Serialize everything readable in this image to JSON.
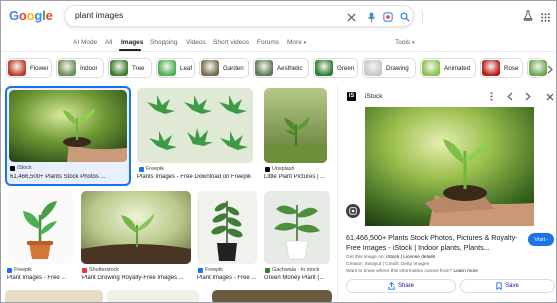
{
  "brand": {
    "logo_letters": [
      {
        "ch": "G",
        "color": "#4285F4"
      },
      {
        "ch": "o",
        "color": "#EA4335"
      },
      {
        "ch": "o",
        "color": "#FBBC05"
      },
      {
        "ch": "g",
        "color": "#4285F4"
      },
      {
        "ch": "l",
        "color": "#34A853"
      },
      {
        "ch": "e",
        "color": "#EA4335"
      }
    ]
  },
  "search": {
    "query": "plant images",
    "icons": [
      "close-icon",
      "mic-icon",
      "lens-icon",
      "search-icon"
    ]
  },
  "header_right": {
    "icons": [
      "labs-flask-icon",
      "apps-grid-icon"
    ]
  },
  "nav": {
    "tabs": [
      {
        "label": "AI Mode"
      },
      {
        "label": "All"
      },
      {
        "label": "Images",
        "active": true
      },
      {
        "label": "Shopping"
      },
      {
        "label": "Videos"
      },
      {
        "label": "Short videos"
      },
      {
        "label": "Forums"
      },
      {
        "label": "More"
      }
    ],
    "tools_label": "Tools"
  },
  "chips": [
    {
      "label": "Flower",
      "color": "#c0392b"
    },
    {
      "label": "Indoor",
      "color": "#6b8e5a"
    },
    {
      "label": "Tree",
      "color": "#3f7d2e"
    },
    {
      "label": "Leaf",
      "color": "#4caf50"
    },
    {
      "label": "Garden",
      "color": "#7a6a4f"
    },
    {
      "label": "Aesthetic",
      "color": "#5d7a52"
    },
    {
      "label": "Green",
      "color": "#2e7d32"
    },
    {
      "label": "Drawing",
      "color": "#c8c8c8"
    },
    {
      "label": "Animated",
      "color": "#8bc34a"
    },
    {
      "label": "Rose",
      "color": "#b71c1c"
    },
    {
      "label": "",
      "color": "#6aa84f"
    }
  ],
  "results": [
    {
      "source": "iStock",
      "caption": "61,466,500+ Plants Stock Photos ...",
      "selected": true
    },
    {
      "source": "Freepik",
      "caption": "Plants Images - Free Download on Freepik"
    },
    {
      "source": "Unsplash",
      "caption": "Little Plant Pictures | ..."
    },
    {
      "source": "Freepik",
      "caption": "Plant Images - Free ..."
    },
    {
      "source": "Shutterstock",
      "caption": "Plant Growing Royalty-Free Images ..."
    },
    {
      "source": "Freepik",
      "caption": "Plant Images - Free ..."
    },
    {
      "source": "Gachwala · In stock",
      "caption": "Green Money Plant (..."
    }
  ],
  "panel": {
    "site": "iStock",
    "logo_letter": "iS",
    "title": "61,466,500+ Plants Stock Photos, Pictures & Royalty-Free Images - iStock | Indoor plants, Plants...",
    "visit_label": "Visit",
    "meta": [
      {
        "label": "Get this image on: ",
        "value": "iStock | License details"
      },
      {
        "label": "Creator: ",
        "value": "Sarayut | Credit: Getty Images"
      },
      {
        "label": "Want to know where this information comes from? ",
        "value": "Learn more"
      }
    ],
    "share_label": "Share",
    "save_label": "Save"
  }
}
